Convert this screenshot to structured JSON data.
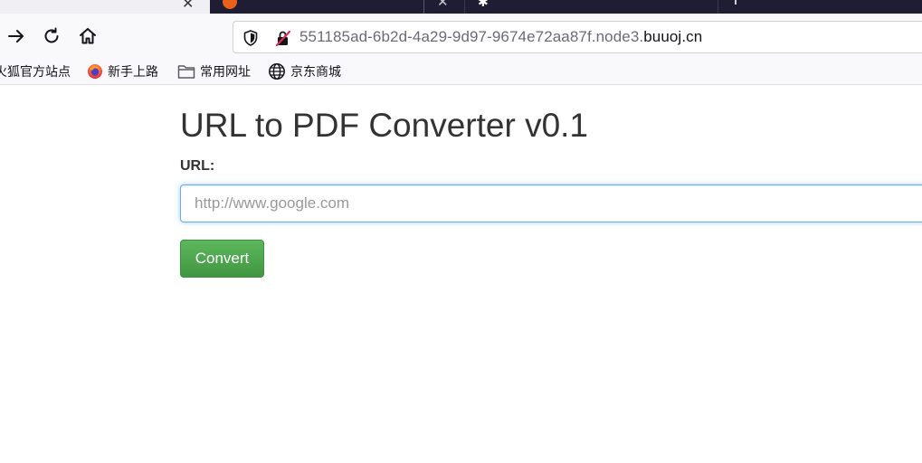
{
  "browser": {
    "tabs": [
      {
        "favicon": "firefox-orange-icon",
        "close": "✕"
      },
      {
        "favicon": "gear-icon",
        "close": ""
      },
      {
        "favicon": "",
        "close": ""
      }
    ],
    "address_bar": {
      "url_prefix": "551185ad-6b2d-4a29-9d97-9674e72aa87f.node3.",
      "url_domain": "buuoj.cn"
    },
    "bookmarks": [
      {
        "label": "火狐官方站点",
        "icon": "firefox-icon"
      },
      {
        "label": "新手上路",
        "icon": "firefox-icon"
      },
      {
        "label": "常用网址",
        "icon": "folder-icon"
      },
      {
        "label": "京东商城",
        "icon": "globe-icon"
      }
    ]
  },
  "page": {
    "title": "URL to PDF Converter v0.1",
    "url_label": "URL:",
    "url_input": {
      "value": "",
      "placeholder": "http://www.google.com"
    },
    "convert_button": "Convert"
  },
  "colors": {
    "button_green": "#5cb85c",
    "input_focus_border": "#66afe9",
    "title_text": "#333333",
    "tab_dark": "#1e1d33"
  }
}
